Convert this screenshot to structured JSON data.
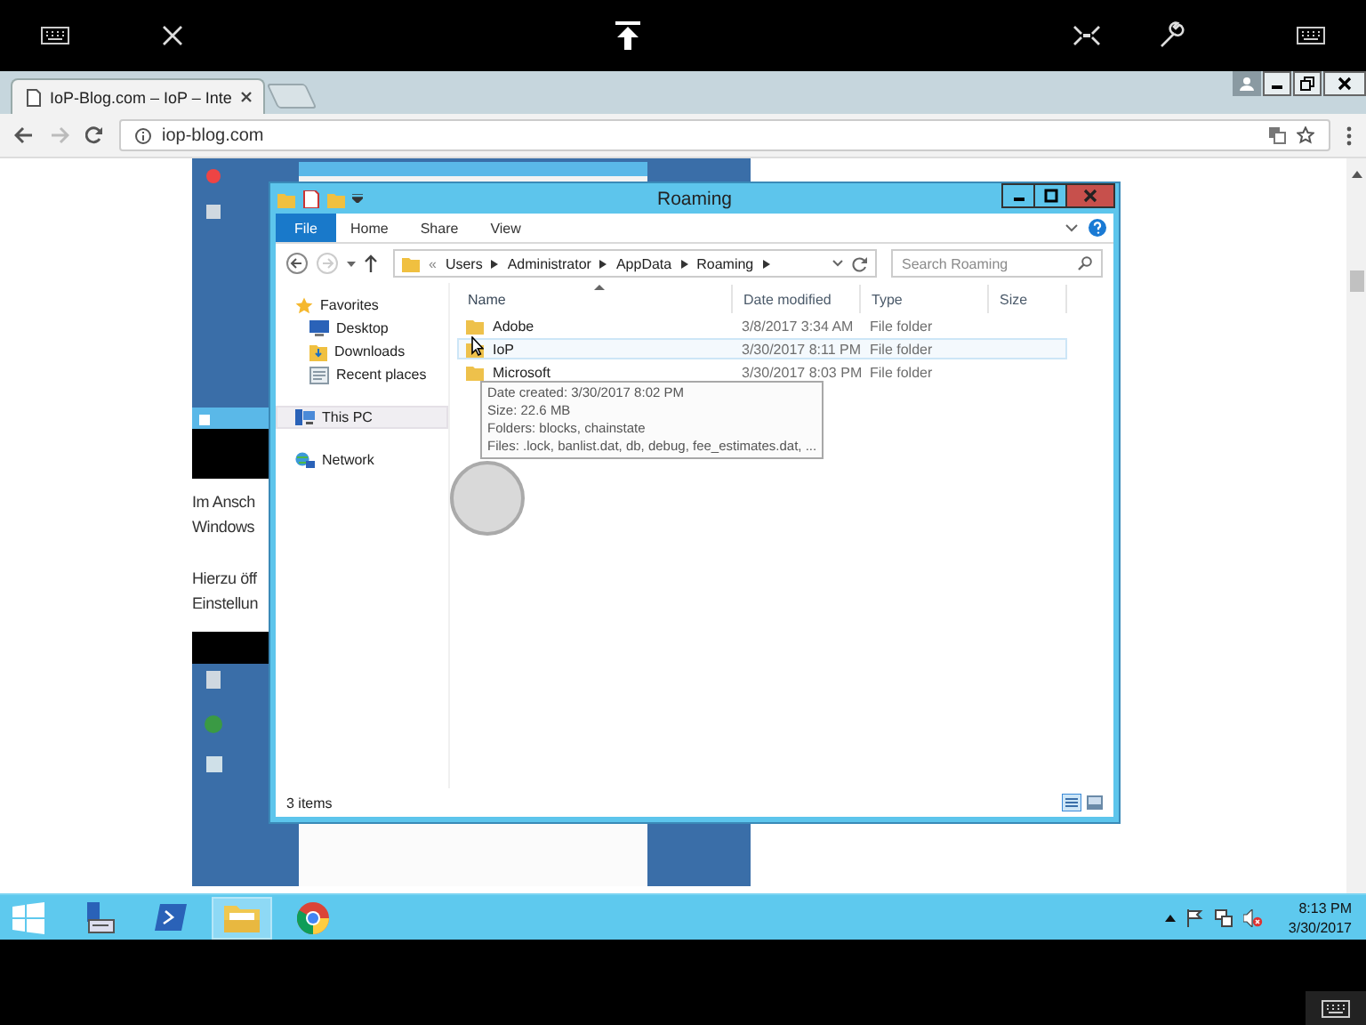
{
  "browser": {
    "tabs": [
      {
        "label": "IoP-Blog.com – IoP – Inte",
        "selected": true
      }
    ],
    "address": "iop-blog.com",
    "article_lines": [
      {
        "text": "Im Ansch"
      },
      {
        "text": "Windows"
      },
      {
        "text": "Hierzu öff"
      },
      {
        "text": "Einstellun"
      }
    ]
  },
  "explorer": {
    "title": "Roaming",
    "ribbon_tabs": [
      {
        "label": "File",
        "kind": "file"
      },
      {
        "label": "Home",
        "kind": "tab"
      },
      {
        "label": "Share",
        "kind": "tab"
      },
      {
        "label": "View",
        "kind": "tab"
      }
    ],
    "breadcrumb_overflow": "«",
    "breadcrumbs": [
      "Users",
      "Administrator",
      "AppData",
      "Roaming"
    ],
    "search": {
      "placeholder": "Search Roaming"
    },
    "nav": [
      {
        "label": "Favorites",
        "kind": "favorites",
        "selected": false,
        "children": [
          {
            "label": "Desktop",
            "kind": "desktop",
            "selected": false
          },
          {
            "label": "Downloads",
            "kind": "downloads",
            "selected": false
          },
          {
            "label": "Recent places",
            "kind": "recent",
            "selected": false
          }
        ]
      },
      {
        "label": "This PC",
        "kind": "pc",
        "selected": true
      },
      {
        "label": "Network",
        "kind": "network",
        "selected": false
      }
    ],
    "columns": [
      {
        "label": "Name",
        "sorted": true
      },
      {
        "label": "Date modified",
        "sorted": false
      },
      {
        "label": "Type",
        "sorted": false
      },
      {
        "label": "Size",
        "sorted": false
      }
    ],
    "rows": [
      {
        "name": "Adobe",
        "date": "3/8/2017 3:34 AM",
        "type": "File folder",
        "selected": false
      },
      {
        "name": "IoP",
        "date": "3/30/2017 8:11 PM",
        "type": "File folder",
        "selected": true
      },
      {
        "name": "Microsoft",
        "date": "3/30/2017 8:03 PM",
        "type": "File folder",
        "selected": false
      }
    ],
    "tooltip": [
      "Date created: 3/30/2017 8:02 PM",
      "Size: 22.6 MB",
      "Folders: blocks, chainstate",
      "Files: .lock, banlist.dat, db, debug, fee_estimates.dat, ..."
    ],
    "status": "3 items"
  },
  "taskbar": {
    "apps": [
      {
        "kind": "server-manager",
        "active": false
      },
      {
        "kind": "powershell",
        "active": false
      },
      {
        "kind": "explorer",
        "active": true
      },
      {
        "kind": "chrome",
        "active": false
      }
    ],
    "time": "8:13 PM",
    "date": "3/30/2017"
  }
}
